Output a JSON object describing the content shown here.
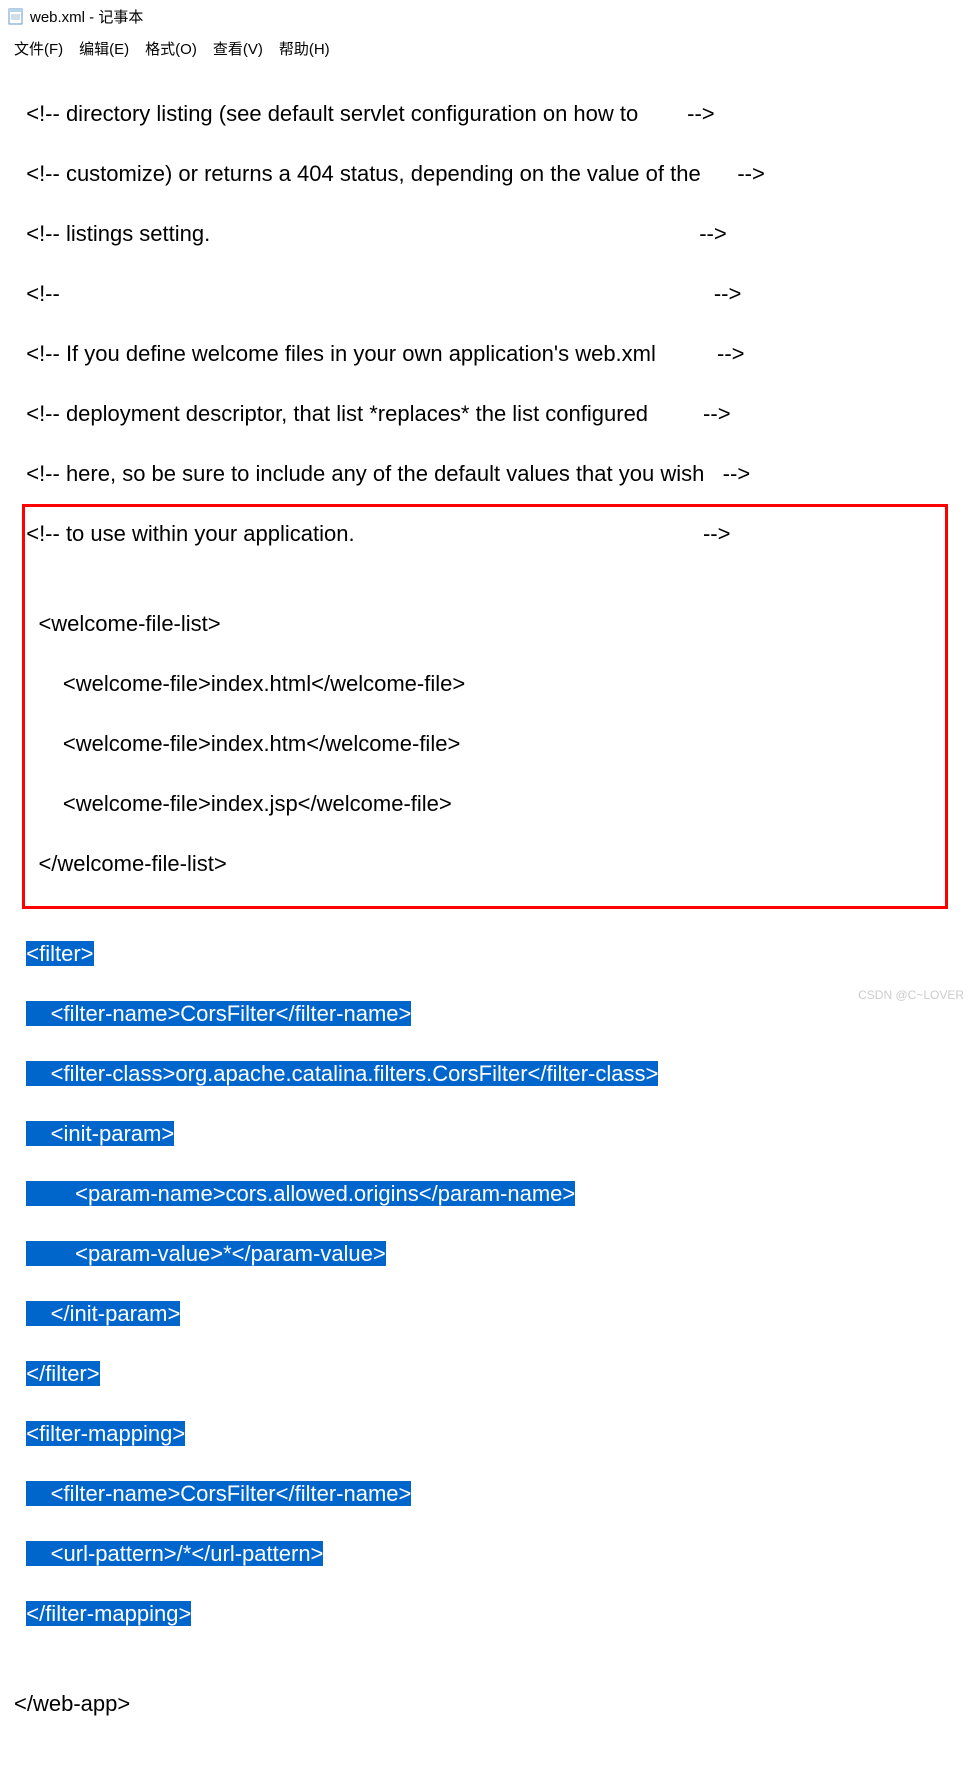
{
  "titlebar": {
    "title": "web.xml - 记事本"
  },
  "menubar": {
    "file": "文件(F)",
    "edit": "编辑(E)",
    "format": "格式(O)",
    "view": "查看(V)",
    "help": "帮助(H)"
  },
  "content": {
    "line1": "  <!-- directory listing (see default servlet configuration on how to        -->",
    "line2": "  <!-- customize) or returns a 404 status, depending on the value of the      -->",
    "line3": "  <!-- listings setting.                                                                                -->",
    "line4": "  <!--                                                                                                           -->",
    "line5": "  <!-- If you define welcome files in your own application's web.xml          -->",
    "line6": "  <!-- deployment descriptor, that list *replaces* the list configured         -->",
    "line7": "  <!-- here, so be sure to include any of the default values that you wish   -->",
    "line8": "  <!-- to use within your application.                                                         -->",
    "line9": "",
    "line10": "    <welcome-file-list>",
    "line11": "        <welcome-file>index.html</welcome-file>",
    "line12": "        <welcome-file>index.htm</welcome-file>",
    "line13": "        <welcome-file>index.jsp</welcome-file>",
    "line14": "    </welcome-file-list>",
    "line15": "",
    "sel1": "<filter>",
    "sel2": "    <filter-name>CorsFilter</filter-name>",
    "sel3": "    <filter-class>org.apache.catalina.filters.CorsFilter</filter-class>",
    "sel4": "    <init-param>",
    "sel5": "        <param-name>cors.allowed.origins</param-name>",
    "sel6": "        <param-value>*</param-value>",
    "sel7": "    </init-param>",
    "sel8": "</filter>",
    "sel9": "<filter-mapping>",
    "sel10": "    <filter-name>CorsFilter</filter-name>",
    "sel11": "    <url-pattern>/*</url-pattern>",
    "sel12": "</filter-mapping>",
    "line28": "",
    "line29": "</web-app>"
  },
  "watermark": "CSDN @C~LOVER"
}
